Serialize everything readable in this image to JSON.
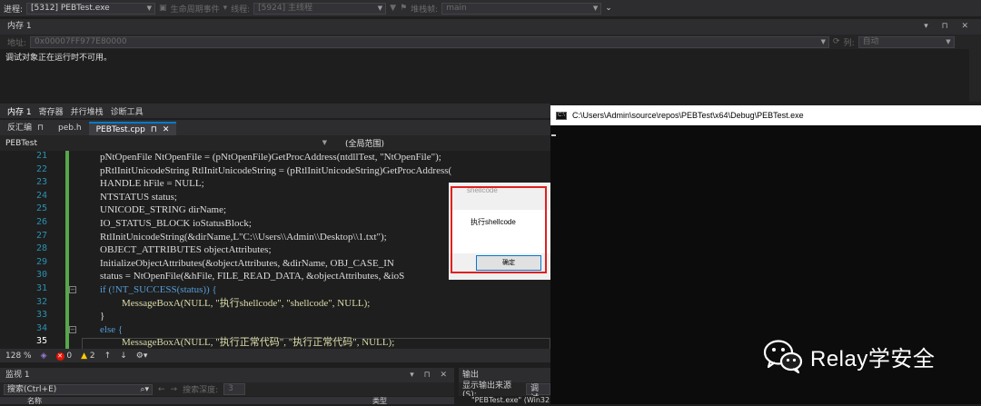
{
  "toolbar": {
    "process_label": "进程:",
    "process_value": "[5312] PEBTest.exe",
    "lifecycle_label": "生命周期事件",
    "thread_label": "线程:",
    "thread_value": "[5924] 主线程",
    "stack_label": "堆栈帧:",
    "stack_value": "main"
  },
  "memory": {
    "title": "内存 1",
    "address_label": "地址:",
    "address_value": "0x00007FF977E80000",
    "columns_label": "列:",
    "columns_value": "自动",
    "message": "调试对象正在运行时不可用。"
  },
  "panel_tabs": [
    "内存 1",
    "寄存器",
    "并行堆栈",
    "诊断工具"
  ],
  "editor": {
    "tabs": [
      {
        "label": "反汇编"
      },
      {
        "label": "peb.h"
      },
      {
        "label": "PEBTest.cpp"
      }
    ],
    "nav_left": "PEBTest",
    "nav_right": "(全局范围)",
    "lines": [
      "21",
      "22",
      "23",
      "24",
      "25",
      "26",
      "27",
      "28",
      "29",
      "30",
      "31",
      "32",
      "33",
      "34",
      "35"
    ],
    "code": [
      "pNtOpenFile NtOpenFile = (pNtOpenFile)GetProcAddress(ntdllTest, \"NtOpenFile\");",
      "pRtlInitUnicodeString RtlInitUnicodeString = (pRtlInitUnicodeString)GetProcAddress(",
      "HANDLE hFile = NULL;",
      "NTSTATUS status;",
      "UNICODE_STRING dirName;",
      "IO_STATUS_BLOCK ioStatusBlock;",
      "RtlInitUnicodeString(&dirName,L\"C:\\\\Users\\\\Admin\\\\Desktop\\\\1.txt\");",
      "OBJECT_ATTRIBUTES objectAttributes;",
      "InitializeObjectAttributes(&objectAttributes, &dirName, OBJ_CASE_IN",
      "status = NtOpenFile(&hFile, FILE_READ_DATA, &objectAttributes, &ioS",
      "if (!NT_SUCCESS(status)) {",
      "MessageBoxA(NULL, \"执行shellcode\", \"shellcode\", NULL);",
      "}",
      "else {",
      "MessageBoxA(NULL, \"执行正常代码\", \"执行正常代码\", NULL);"
    ],
    "zoom": "128 %",
    "errors": "0",
    "warnings": "2"
  },
  "watch": {
    "title": "监视 1",
    "search_placeholder": "搜索(Ctrl+E)",
    "depth_label": "搜索深度:",
    "depth_value": "3",
    "col_name": "名称",
    "col_type": "类型"
  },
  "output": {
    "title": "输出",
    "source_label": "显示输出来源(S):",
    "source_value": "调试",
    "text": "\"PEBTest.exe\" (Win32"
  },
  "console": {
    "title": "C:\\Users\\Admin\\source\\repos\\PEBTest\\x64\\Debug\\PEBTest.exe"
  },
  "messagebox": {
    "title": "shellcode",
    "text": "执行shellcode",
    "ok": "确定"
  },
  "watermark": {
    "text": "Relay学安全"
  }
}
